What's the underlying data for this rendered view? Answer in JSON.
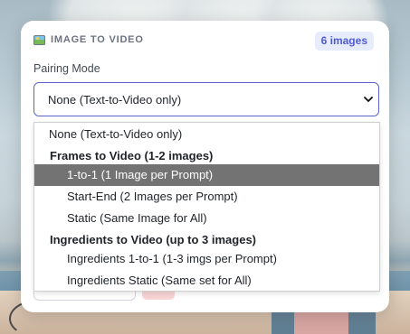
{
  "panel": {
    "title": "IMAGE TO VIDEO",
    "image_count_badge": "6 images",
    "pairing_label": "Pairing Mode",
    "select": {
      "value": "None (Text-to-Video only)"
    }
  },
  "dropdown": {
    "top_option": "None (Text-to-Video only)",
    "groups": [
      {
        "label": "Frames to Video (1-2 images)",
        "options": [
          "1-to-1 (1 Image per Prompt)",
          "Start-End (2 Images per Prompt)",
          "Static (Same Image for All)"
        ]
      },
      {
        "label": "Ingredients to Video (up to 3 images)",
        "options": [
          "Ingredients 1-to-1 (1-3 imgs per Prompt)",
          "Ingredients Static (Same set for All)"
        ]
      }
    ],
    "highlighted_option": "1-to-1 (1 Image per Prompt)"
  },
  "colors": {
    "accent": "#5b63c9",
    "badge_bg": "#e7ecfd",
    "badge_text": "#4f5bd5",
    "highlight": "#737373"
  },
  "icons": {
    "title_icon": "picture-icon",
    "select_chevron": "chevron-down-icon"
  }
}
